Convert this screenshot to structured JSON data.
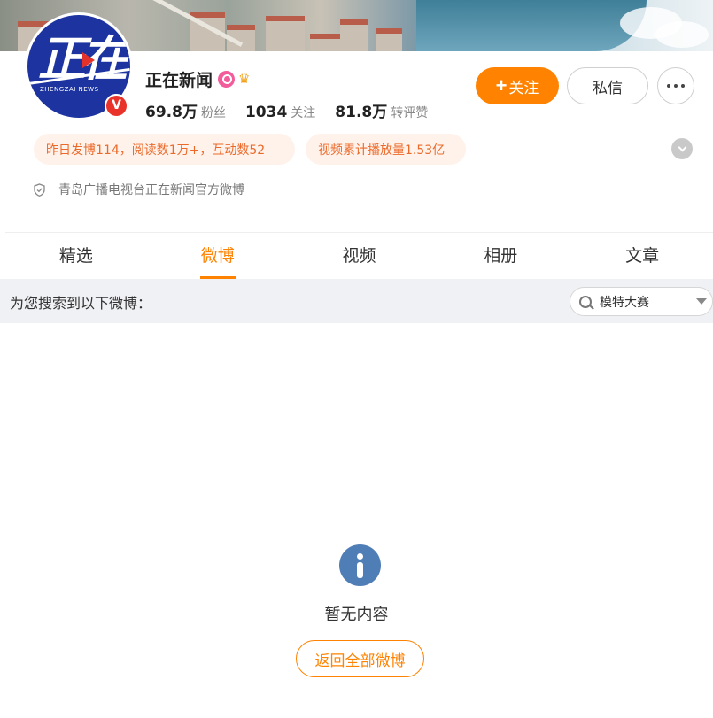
{
  "profile": {
    "name": "正在新闻",
    "avatar_logo": "正在",
    "avatar_sub": "ZHENGZAI NEWS",
    "verified_mark": "V",
    "description": "青岛广播电视台正在新闻官方微博",
    "stats": [
      {
        "value": "69.8万",
        "label": "粉丝"
      },
      {
        "value": "1034",
        "label": "关注"
      },
      {
        "value": "81.8万",
        "label": "转评赞"
      }
    ]
  },
  "actions": {
    "follow_plus": "+",
    "follow_label": "关注",
    "message_label": "私信"
  },
  "pills": [
    "昨日发博114，阅读数1万+，互动数52",
    "视频累计播放量1.53亿"
  ],
  "tabs": [
    "精选",
    "微博",
    "视频",
    "相册",
    "文章"
  ],
  "active_tab": "微博",
  "search": {
    "hint": "为您搜索到以下微博：",
    "value": "模特大赛"
  },
  "empty": {
    "message": "暂无内容",
    "back_button": "返回全部微博"
  },
  "colors": {
    "accent": "#ff8200",
    "pill_bg": "#fff2ea",
    "pill_text": "#eb6a2a",
    "info_icon": "#4f7db6",
    "avatar_bg": "#1c33a0",
    "verified_red": "#e8322a"
  },
  "icons": [
    "pink-badge-icon",
    "crown-icon",
    "more-dots-icon",
    "chevron-down-icon",
    "shield-icon",
    "search-icon",
    "caret-down-icon",
    "info-icon"
  ]
}
